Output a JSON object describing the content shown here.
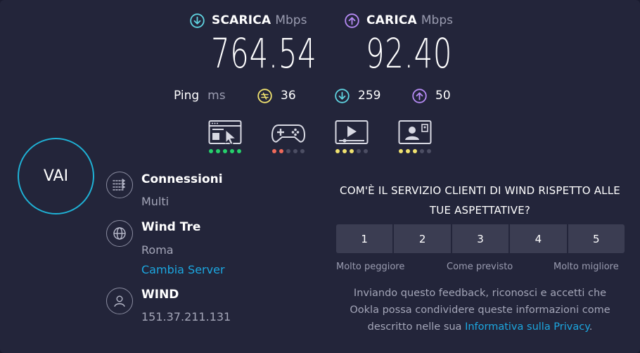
{
  "download": {
    "title": "SCARICA",
    "unit": "Mbps",
    "value": "764.54",
    "color": "#5fd3e0"
  },
  "upload": {
    "title": "CARICA",
    "unit": "Mbps",
    "value": "92.40",
    "color": "#b68bf5"
  },
  "ping": {
    "label": "Ping",
    "unit": "ms",
    "idle": "36",
    "download": "259",
    "upload": "50",
    "idle_color": "#f1e36f"
  },
  "usage": [
    {
      "name": "web-browsing",
      "dots": [
        "green",
        "green",
        "green",
        "green",
        "green"
      ]
    },
    {
      "name": "gaming",
      "dots": [
        "red",
        "red",
        "gray",
        "gray",
        "gray"
      ]
    },
    {
      "name": "streaming",
      "dots": [
        "yellow",
        "yellow",
        "yellow",
        "gray",
        "gray"
      ]
    },
    {
      "name": "video-chat",
      "dots": [
        "yellow",
        "yellow",
        "yellow",
        "gray",
        "gray"
      ]
    }
  ],
  "go_label": "VAI",
  "connections": {
    "title": "Connessioni",
    "value": "Multi"
  },
  "server": {
    "title": "Wind Tre",
    "location": "Roma",
    "change_link": "Cambia Server"
  },
  "provider": {
    "title": "WIND",
    "ip": "151.37.211.131"
  },
  "survey": {
    "question_line1": "COM'È IL SERVIZIO CLIENTI DI WIND RISPETTO ALLE",
    "question_line2": "TUE ASPETTATIVE?",
    "options": [
      "1",
      "2",
      "3",
      "4",
      "5"
    ],
    "low_label": "Molto peggiore",
    "mid_label": "Come previsto",
    "high_label": "Molto migliore",
    "disclaimer_line1": "Inviando questo feedback, riconosci e accetti che",
    "disclaimer_line2": "Ookla possa condividere queste informazioni come",
    "disclaimer_line3": "descritto nelle sua",
    "privacy_link": "Informativa sulla Privacy",
    "disclaimer_end": "."
  },
  "colors": {
    "background": "#23253a",
    "accent": "#1ca7e0",
    "go_ring": "#1fb2d6"
  }
}
